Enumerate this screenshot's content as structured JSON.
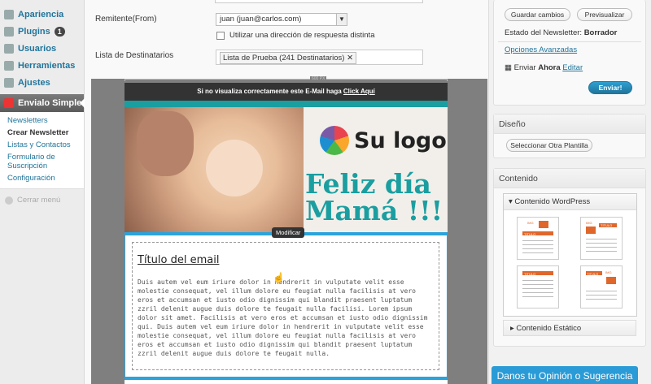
{
  "sidebar": {
    "items": [
      {
        "label": "Apariencia"
      },
      {
        "label": "Plugins",
        "badge": "1"
      },
      {
        "label": "Usuarios"
      },
      {
        "label": "Herramientas"
      },
      {
        "label": "Ajustes"
      }
    ],
    "active": "Envialo Simple",
    "submenu": [
      "Newsletters",
      "Crear Newsletter",
      "Listas y Contactos",
      "Formulario de Suscripción",
      "Configuración"
    ],
    "collapse": "Cerrar menú"
  },
  "form": {
    "from_label": "Remitente(From)",
    "from_value": "juan (juan@carlos.com)",
    "reply_checkbox": "Utilizar una dirección de respuesta distinta",
    "recipients_label": "Lista de Destinatarios",
    "recipient_tag": "Lista de Prueba (241 Destinatarios)"
  },
  "editor": {
    "ruler": "600 PX",
    "top_bar_text": "Si no visualiza correctamente este E-Mail haga",
    "top_bar_link": "Click Aquí",
    "logo_text": "Su logo",
    "headline_1": "Feliz día",
    "headline_2": "Mamá !!!",
    "modify_label": "Modificar",
    "email_title": "Título del email",
    "email_body": "Duis autem vel eum iriure dolor in hendrerit in vulputate velit esse molestie consequat, vel illum dolore eu feugiat nulla facilisis at vero eros et accumsan et iusto odio dignissim qui blandit praesent luptatum zzril delenit augue duis dolore te feugait nulla facilisi. Lorem ipsum dolor sit amet. Facilisis at vero eros et accumsan et iusto odio dignissim qui. Duis autem vel eum iriure dolor in hendrerit in vulputate velit esse molestie consequat, vel illum dolore eu feugiat nulla facilisis at vero eros et accumsan et iusto odio dignissim qui blandit praesent luptatum zzril delenit augue duis dolore te feugait nulla."
  },
  "publish": {
    "save_button": "Guardar cambios",
    "preview_button": "Previsualizar",
    "status_label": "Estado del Newsletter:",
    "status_value": "Borrador",
    "advanced_link": "Opciones Avanzadas",
    "send_label": "Enviar",
    "send_when": "Ahora",
    "edit_link": "Editar",
    "send_button": "Enviar!"
  },
  "design": {
    "title": "Diseño",
    "select_button": "Seleccionar Otra Plantilla"
  },
  "content": {
    "title": "Contenido",
    "wordpress_section": "Contenido WordPress",
    "static_section": "Contenido Estático",
    "template_labels": {
      "img": "IMG",
      "title": "TITULO"
    }
  },
  "feedback": "Danos tu Opinión o Sugerencia",
  "colors": {
    "teal": "#1b9ea0",
    "block_border": "#2aa4dc",
    "link": "#21759b"
  }
}
